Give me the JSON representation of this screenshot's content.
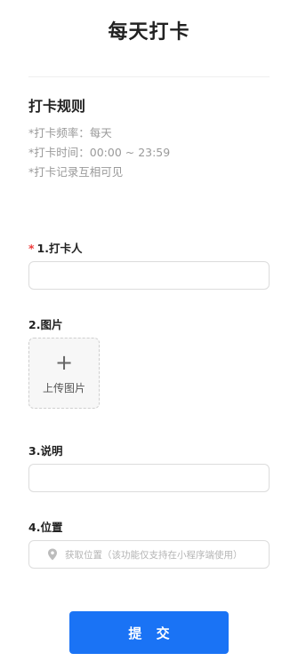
{
  "header": {
    "title": "每天打卡"
  },
  "rules": {
    "title": "打卡规则",
    "lines": [
      "*打卡频率：每天",
      "*打卡时间：00:00 ~ 23:59",
      "*打卡记录互相可见"
    ]
  },
  "form": {
    "field1": {
      "required_mark": "*",
      "label": "1.打卡人",
      "value": ""
    },
    "field2": {
      "label": "2.图片",
      "upload_text": "上传图片",
      "upload_icon": "plus-icon"
    },
    "field3": {
      "label": "3.说明",
      "value": ""
    },
    "field4": {
      "label": "4.位置",
      "placeholder": "获取位置（该功能仅支持在小程序端使用）",
      "icon": "location-pin-icon"
    }
  },
  "submit": {
    "label": "提 交"
  },
  "colors": {
    "accent": "#1a73f5",
    "required": "#ee3b3b",
    "muted": "#9a9a9a"
  }
}
